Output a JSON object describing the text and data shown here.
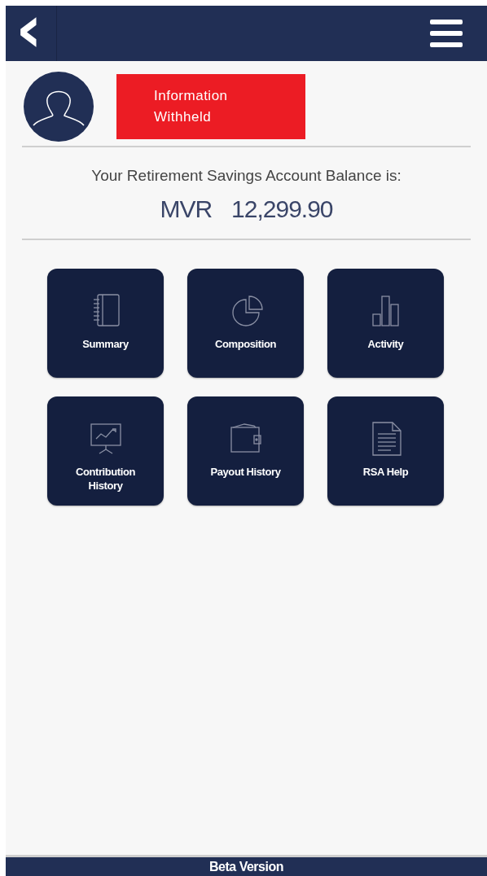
{
  "header": {
    "back": "‹"
  },
  "profile": {
    "name": "Information Withheld"
  },
  "balance": {
    "label": "Your Retirement Savings Account Balance is:",
    "currency": "MVR",
    "amount": "12,299.90"
  },
  "tiles": [
    {
      "kind": "notebook",
      "label": "Summary"
    },
    {
      "kind": "pie",
      "label": "Composition"
    },
    {
      "kind": "bars",
      "label": "Activity"
    },
    {
      "kind": "board",
      "label": "Contribution History"
    },
    {
      "kind": "wallet",
      "label": "Payout History"
    },
    {
      "kind": "document",
      "label": "RSA Help"
    }
  ],
  "footer": {
    "text": "Beta Version"
  }
}
